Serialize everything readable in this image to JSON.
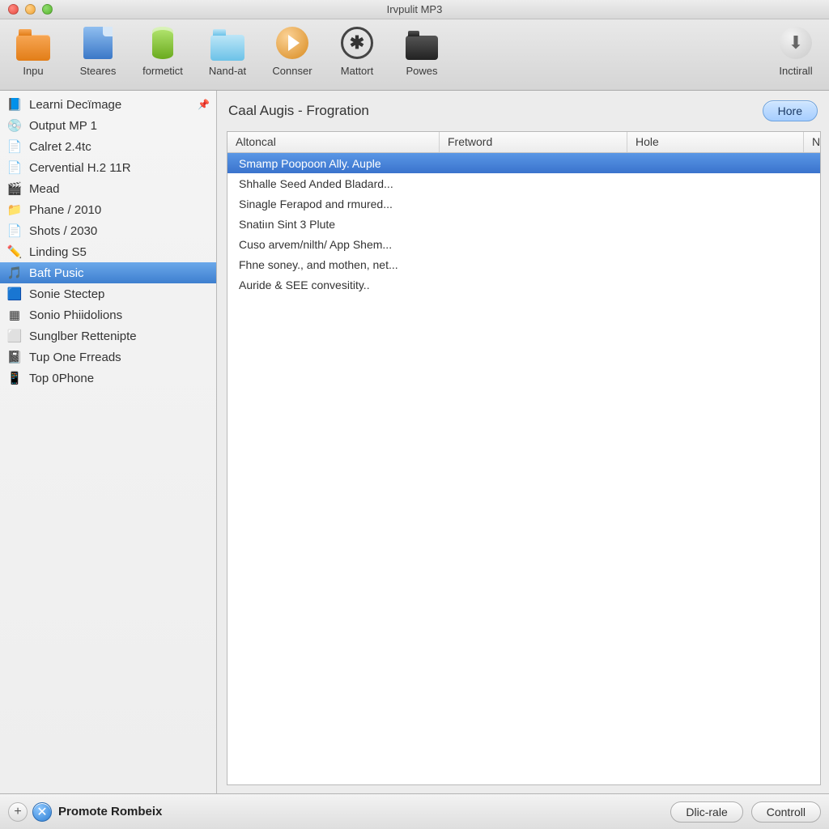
{
  "window": {
    "title": "Irvpulit MP3"
  },
  "toolbar": {
    "items": [
      {
        "label": "Inpu",
        "icon": "folder-orange"
      },
      {
        "label": "Steares",
        "icon": "doc-blue"
      },
      {
        "label": "formetict",
        "icon": "cylinder-green"
      },
      {
        "label": "Nand-at",
        "icon": "folder-cyan"
      },
      {
        "label": "Connser",
        "icon": "play"
      },
      {
        "label": "Mattort",
        "icon": "bolt"
      },
      {
        "label": "Powes",
        "icon": "folder-dark"
      }
    ],
    "right": {
      "label": "Inctirall",
      "icon": "download"
    }
  },
  "sidebar": {
    "items": [
      {
        "label": "Learni Decïmage",
        "icon": "📘",
        "pinned": true
      },
      {
        "label": "Output MP 1",
        "icon": "💿"
      },
      {
        "label": "Calret 2.4tc",
        "icon": "📄"
      },
      {
        "label": "Cervential H.2 11R",
        "icon": "📄"
      },
      {
        "label": "Mead",
        "icon": "🎬"
      },
      {
        "label": "Phane / 2010",
        "icon": "📁"
      },
      {
        "label": "Shots / 2030",
        "icon": "📄"
      },
      {
        "label": "Linding S5",
        "icon": "✏️"
      },
      {
        "label": "Baft Pusic",
        "icon": "🎵",
        "selected": true
      },
      {
        "label": "Sonie Stectep",
        "icon": "🟦"
      },
      {
        "label": "Sonio Phiidolions",
        "icon": "▦"
      },
      {
        "label": "Sunglber Rettenipte",
        "icon": "⬜"
      },
      {
        "label": "Tup One Frreads",
        "icon": "📓"
      },
      {
        "label": "Top 0Phone",
        "icon": "📱"
      }
    ]
  },
  "main": {
    "title": "Caal Augis - Frogration",
    "hore_button": "Hore",
    "columns": [
      "Altoncal",
      "Fretword",
      "Hole",
      "N"
    ],
    "rows": [
      {
        "a": "Smamp Poopoon Ally. Auple",
        "selected": true
      },
      {
        "a": "Shhalle Seed Anded Bladard..."
      },
      {
        "a": "Sinagle Ferapod and rmured..."
      },
      {
        "a": "Snatiın Sint 3 Plute"
      },
      {
        "a": "Cuso arvem/nilth/ App Shem..."
      },
      {
        "a": "Fhne soney., and mothen, net..."
      },
      {
        "a": "Auride & SEE convesitity.."
      }
    ]
  },
  "bottombar": {
    "promote": "Promote Rombeix",
    "buttons": [
      "Dlic-rale",
      "Controll"
    ]
  }
}
